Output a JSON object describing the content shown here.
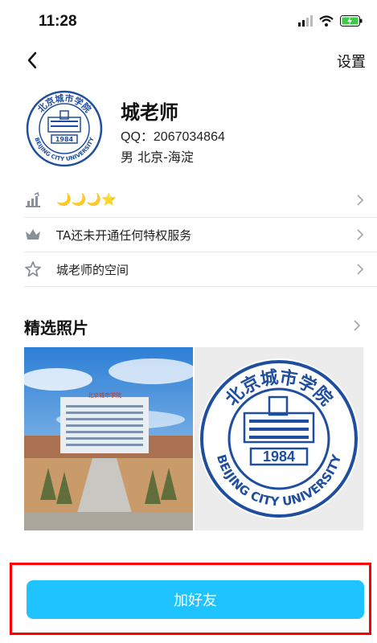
{
  "status": {
    "time": "11:28"
  },
  "nav": {
    "settings_label": "设置"
  },
  "profile": {
    "name": "城老师",
    "qq": "QQ：2067034864",
    "gender_location": "男   北京-海淀",
    "avatar_text_top": "北京城市学院",
    "avatar_text_bottom": "BEIJING CITY UNIVERSITY",
    "avatar_year": "1984"
  },
  "rows": [
    {
      "icon": "level-chart-icon",
      "text": "🌙🌙🌙⭐"
    },
    {
      "icon": "crown-icon",
      "text": "TA还未开通任何特权服务"
    },
    {
      "icon": "star-space-icon",
      "text": "城老师的空间"
    }
  ],
  "photos": {
    "title": "精选照片",
    "building_sign": "北京城市学院",
    "logo_text_top": "北京城市学院",
    "logo_text_bottom": "BEIJING CITY UNIVERSITY",
    "logo_year": "1984"
  },
  "actions": {
    "add_friend": "加好友"
  },
  "colors": {
    "accent": "#1ec3ff",
    "highlight": "#ff0000",
    "logo_blue": "#1f4ea0"
  }
}
